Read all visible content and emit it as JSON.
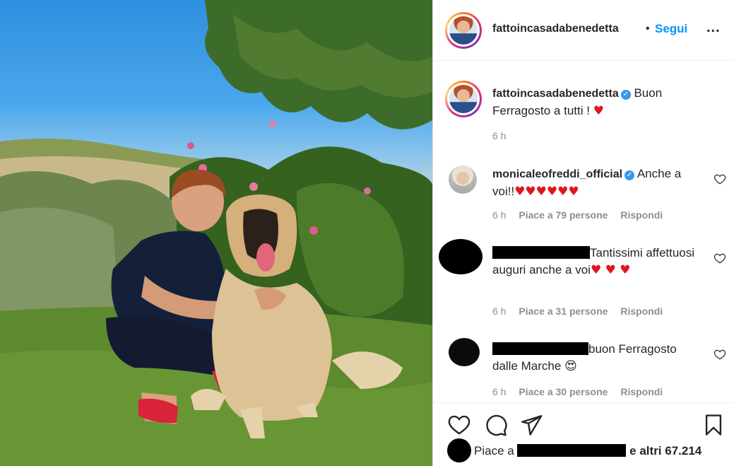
{
  "post": {
    "author": "fattoincasadabenedetta",
    "follow_label": "Segui",
    "separator": "•",
    "more_label": "..."
  },
  "caption": {
    "username": "fattoincasadabenedetta",
    "text": "Buon Ferragosto a tutti !",
    "emoji": "♥",
    "time": "6 h"
  },
  "comments": [
    {
      "username": "monicaleofreddi_official",
      "text": "Anche a voi!!",
      "emoji": "♥♥♥♥♥♥",
      "time": "6 h",
      "likes": "Piace a 79 persone",
      "reply": "Rispondi"
    },
    {
      "text": "Tantissimi affettuosi auguri anche a voi",
      "emoji": "♥ ♥ ♥",
      "time": "6 h",
      "likes": "Piace a 31 persone",
      "reply": "Rispondi"
    },
    {
      "text": "buon Ferragosto dalle Marche",
      "emoji": "😍",
      "time": "6 h",
      "likes": "Piace a 30 persone",
      "reply": "Rispondi"
    }
  ],
  "likes_bar": {
    "prefix": "Piace a",
    "suffix": "e altri 67.214"
  },
  "colors": {
    "accent": "#0095f6",
    "verified": "#3897f0",
    "muted": "#8e8e8e",
    "heart": "#e0161e"
  },
  "icons": [
    "like-icon",
    "comment-icon",
    "share-icon",
    "save-icon",
    "heart-small-icon",
    "verified-icon",
    "more-icon"
  ]
}
